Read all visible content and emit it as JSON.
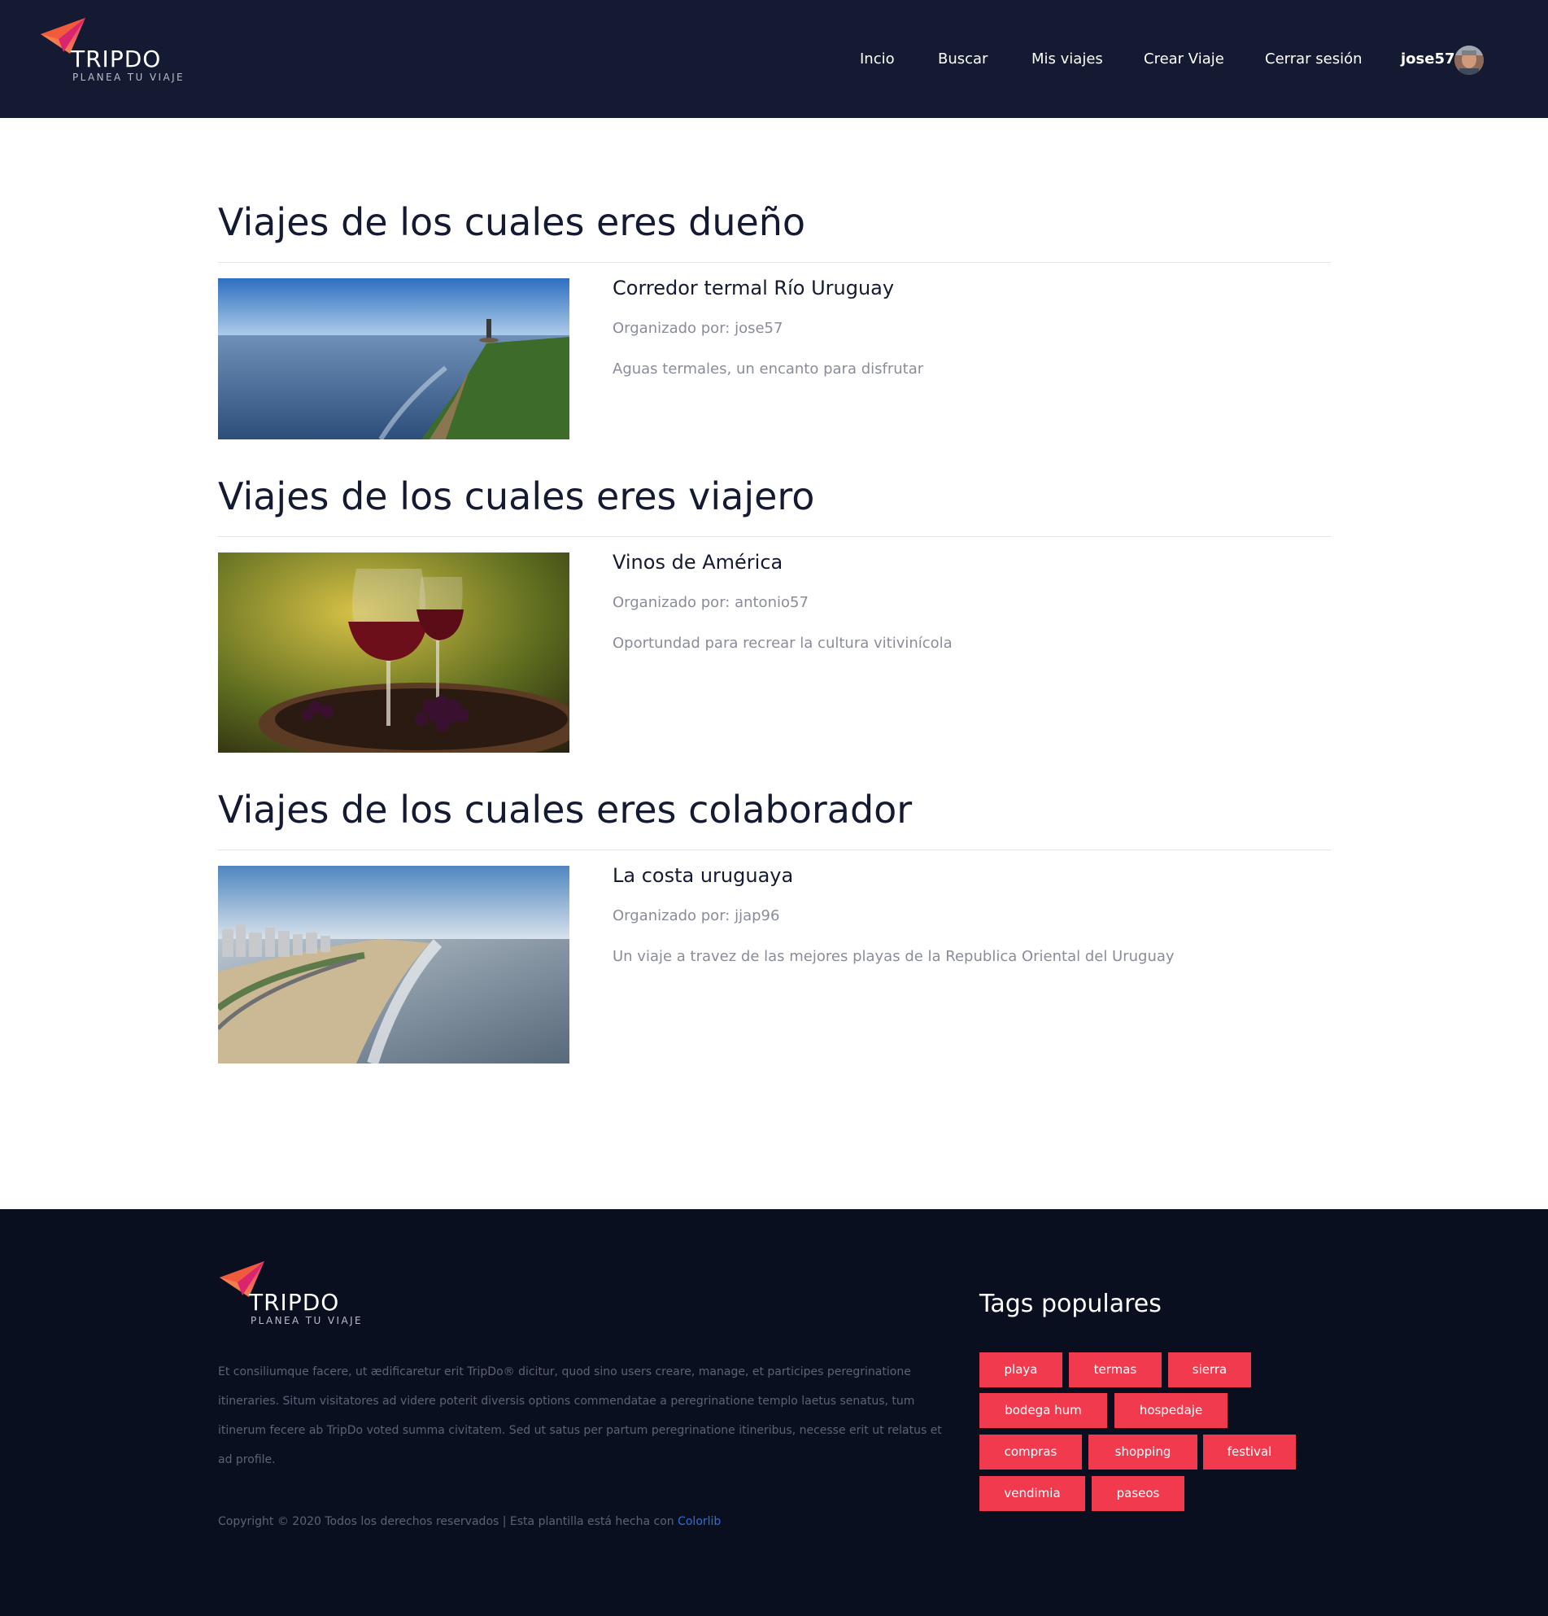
{
  "brand": {
    "name": "TRIPDO",
    "tagline": "PLANEA TU VIAJE"
  },
  "nav": {
    "items": [
      "Incio",
      "Buscar",
      "Mis viajes",
      "Crear Viaje",
      "Cerrar sesión"
    ],
    "user": "jose57"
  },
  "sections": [
    {
      "title": "Viajes de los cuales eres dueño",
      "trip": {
        "name": "Corredor termal Río Uruguay",
        "organizer": "Organizado por: jose57",
        "description": "Aguas termales, un encanto para disfrutar"
      }
    },
    {
      "title": "Viajes de los cuales eres viajero",
      "trip": {
        "name": "Vinos de América",
        "organizer": "Organizado por: antonio57",
        "description": "Oportundad para recrear la cultura vitivinícola"
      }
    },
    {
      "title": "Viajes de los cuales eres colaborador",
      "trip": {
        "name": "La costa uruguaya",
        "organizer": "Organizado por: jjap96",
        "description": "Un viaje a travez de las mejores playas de la Republica Oriental del Uruguay"
      }
    }
  ],
  "footer": {
    "about": "Et consiliumque facere, ut ædificaretur erit TripDo® dicitur, quod sino users creare, manage, et participes peregrinatione itineraries. Situm visitatores ad videre poterit diversis options commendatae a peregrinatione templo laetus senatus, tum itinerum fecere ab TripDo voted summa civitatem. Sed ut satus per partum peregrinatione itineribus, necesse erit ut relatus et ad profile.",
    "copyright": "Copyright © 2020 Todos los derechos reservados | Esta plantilla está hecha con ",
    "copyright_link": "Colorlib",
    "tags_title": "Tags populares",
    "tags": [
      "playa",
      "termas",
      "sierra",
      "bodega hum",
      "hospedaje",
      "compras",
      "shopping",
      "festival",
      "vendimia",
      "paseos"
    ]
  },
  "colors": {
    "header_bg": "#141a32",
    "footer_bg": "#0a0f20",
    "tag_bg": "#f23a4e",
    "link": "#2f6fd8"
  }
}
